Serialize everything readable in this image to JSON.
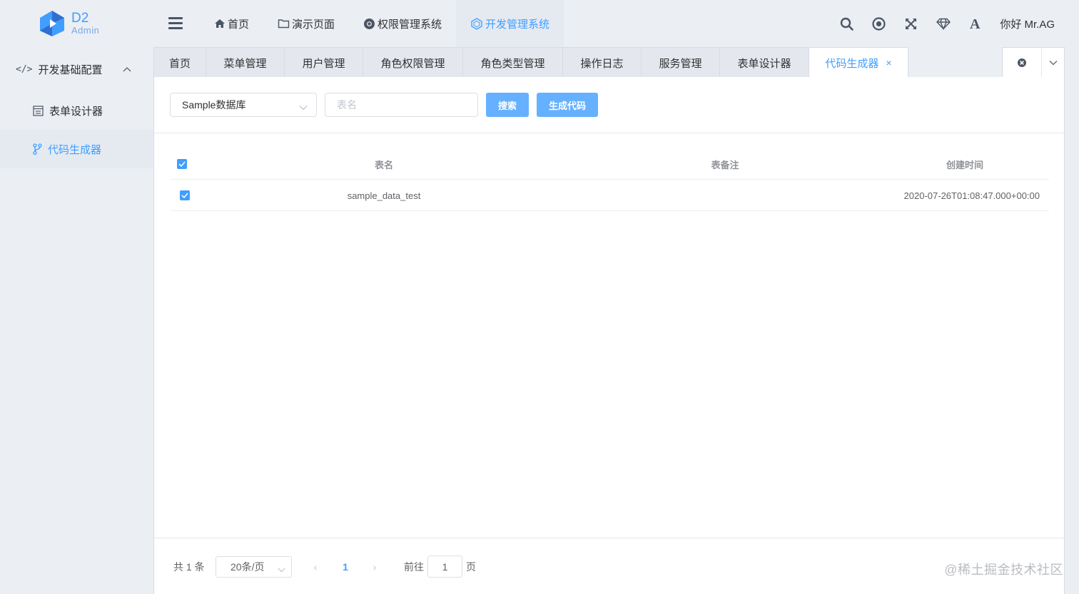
{
  "brand": {
    "name": "D2",
    "sub": "Admin",
    "accent": "#409eff"
  },
  "topnav": {
    "items": [
      {
        "label": "首页",
        "icon": "home-icon"
      },
      {
        "label": "演示页面",
        "icon": "folder-icon"
      },
      {
        "label": "权限管理系统",
        "icon": "chrome-icon"
      },
      {
        "label": "开发管理系统",
        "icon": "hexagon-icon",
        "active": true
      }
    ]
  },
  "toolbar": {
    "icons": [
      "search-icon",
      "record-icon",
      "fullscreen-icon",
      "diamond-icon",
      "font-size-icon"
    ],
    "greeting": "你好 Mr.AG"
  },
  "sidebar": {
    "group": {
      "label": "开发基础配置",
      "icon": "code-icon",
      "expanded": true
    },
    "items": [
      {
        "label": "表单设计器",
        "icon": "form-icon"
      },
      {
        "label": "代码生成器",
        "icon": "branch-icon",
        "active": true
      }
    ]
  },
  "tabs": {
    "items": [
      {
        "label": "首页"
      },
      {
        "label": "菜单管理"
      },
      {
        "label": "用户管理"
      },
      {
        "label": "角色权限管理"
      },
      {
        "label": "角色类型管理"
      },
      {
        "label": "操作日志"
      },
      {
        "label": "服务管理"
      },
      {
        "label": "表单设计器"
      },
      {
        "label": "代码生成器",
        "active": true,
        "closable": true
      }
    ],
    "close_symbol": "×"
  },
  "search": {
    "database": "Sample数据库",
    "table_placeholder": "表名",
    "search_label": "搜索",
    "generate_label": "生成代码"
  },
  "table": {
    "columns": [
      "表名",
      "表备注",
      "创建时间"
    ],
    "header_checked": true,
    "rows": [
      {
        "checked": true,
        "name": "sample_data_test",
        "remark": "",
        "created": "2020-07-26T01:08:47.000+00:00"
      }
    ]
  },
  "pagination": {
    "total_text": "共 1 条",
    "page_size": "20条/页",
    "prev": "‹",
    "current_page": "1",
    "next": "›",
    "goto_label": "前往",
    "goto_value": "1",
    "page_suffix": "页"
  },
  "watermark": "@稀土掘金技术社区"
}
